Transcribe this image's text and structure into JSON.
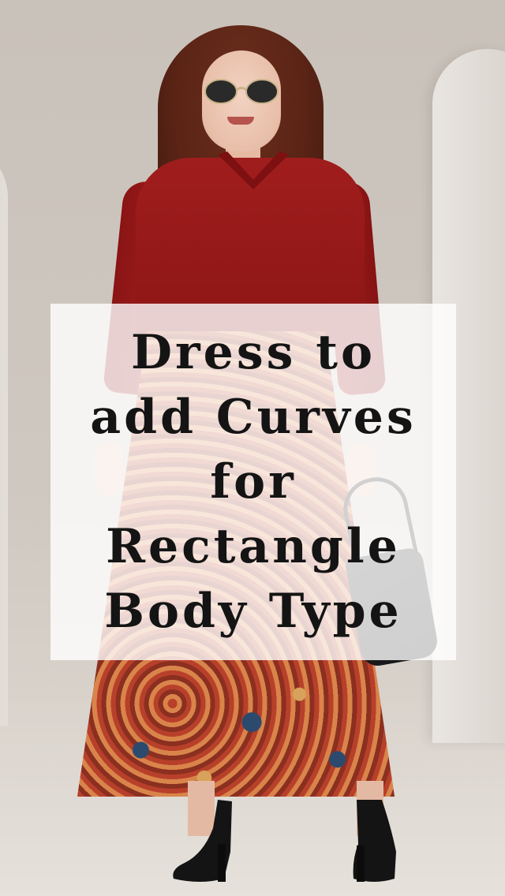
{
  "caption": {
    "lines": [
      "Dress to",
      "add Curves",
      "for",
      "Rectangle",
      "Body Type"
    ]
  },
  "photo": {
    "subject": "woman in red shirt and printed maxi skirt",
    "colors": {
      "shirt": "#a01d1d",
      "skirt": "#b5472e",
      "background": "#c9c2ba",
      "overlay": "#ffffff"
    }
  }
}
